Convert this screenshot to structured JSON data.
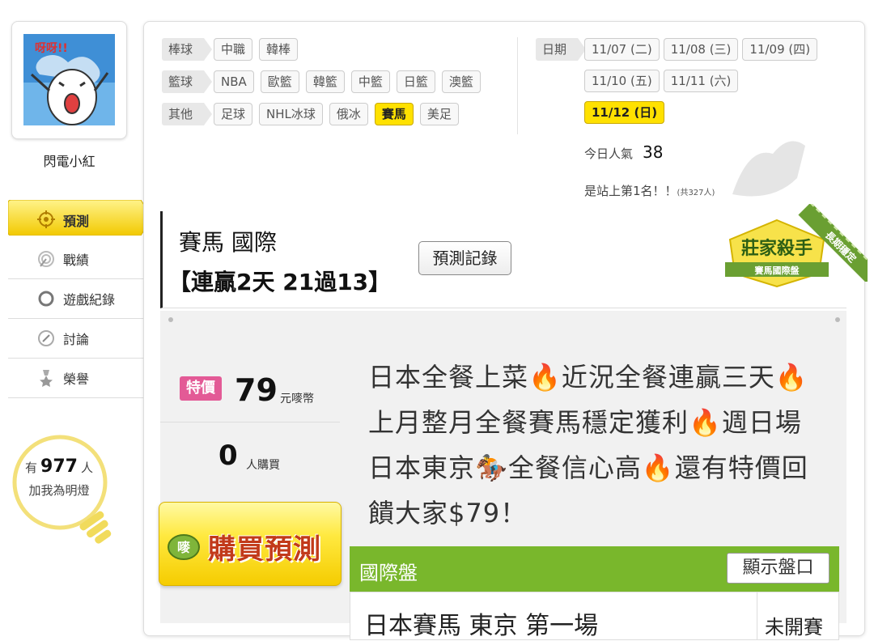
{
  "user": {
    "name": "閃電小紅",
    "avatar_text": "呀呀!!"
  },
  "nav": [
    {
      "label": "預測",
      "icon": "crosshair-icon",
      "active": true
    },
    {
      "label": "戰績",
      "icon": "target-icon",
      "active": false
    },
    {
      "label": "遊戲紀錄",
      "icon": "circle-icon",
      "active": false
    },
    {
      "label": "討論",
      "icon": "chat-icon",
      "active": false
    },
    {
      "label": "榮譽",
      "icon": "medal-icon",
      "active": false
    }
  ],
  "fans": {
    "prefix": "有",
    "count": "977",
    "suffix": "人",
    "subtitle": "加我為明燈"
  },
  "filters": {
    "baseball": {
      "label": "棒球",
      "items": [
        "中職",
        "韓棒"
      ]
    },
    "basketball": {
      "label": "籃球",
      "items": [
        "NBA",
        "歐籃",
        "韓籃",
        "中籃",
        "日籃",
        "澳籃"
      ]
    },
    "other": {
      "label": "其他",
      "items": [
        "足球",
        "NHL冰球",
        "俄冰",
        "賽馬",
        "美足"
      ],
      "selected": "賽馬"
    }
  },
  "dates": {
    "label": "日期",
    "items": [
      "11/07 (二)",
      "11/08 (三)",
      "11/09 (四)",
      "11/10 (五)",
      "11/11 (六)",
      "11/12 (日)"
    ],
    "selected": "11/12 (日)"
  },
  "stats": {
    "popular_label": "今日人氣",
    "popular_value": "38",
    "rank_text": "是站上第1名！！",
    "rank_total": "(共327人)"
  },
  "prediction": {
    "title": "賽馬 國際",
    "streak": "【連贏2天 21過13】",
    "record_button": "預測記錄",
    "badge_title": "莊家殺手",
    "badge_sub": "賽馬國際盤",
    "ribbon": "長期穩定"
  },
  "offer": {
    "special_label": "特價",
    "price": "79",
    "price_unit": "元嘜幣",
    "buyers": "0",
    "buyers_unit": "人購買",
    "buy_button": "購買預測",
    "buy_icon_text": "嘜"
  },
  "description": "日本全餐上菜🔥近況全餐連贏三天🔥上月整月全餐賽馬穩定獲利🔥週日場日本東京🏇全餐信心高🔥還有特價回饋大家$79！",
  "market": {
    "title": "國際盤",
    "show_button": "顯示盤口",
    "race_name": "日本賽馬 東京 第一場",
    "race_type": "未開賽"
  },
  "colors": {
    "accent_yellow": "#ffe100",
    "green": "#79b72c",
    "pink": "#e35a96",
    "red_text": "#c23a1a"
  }
}
